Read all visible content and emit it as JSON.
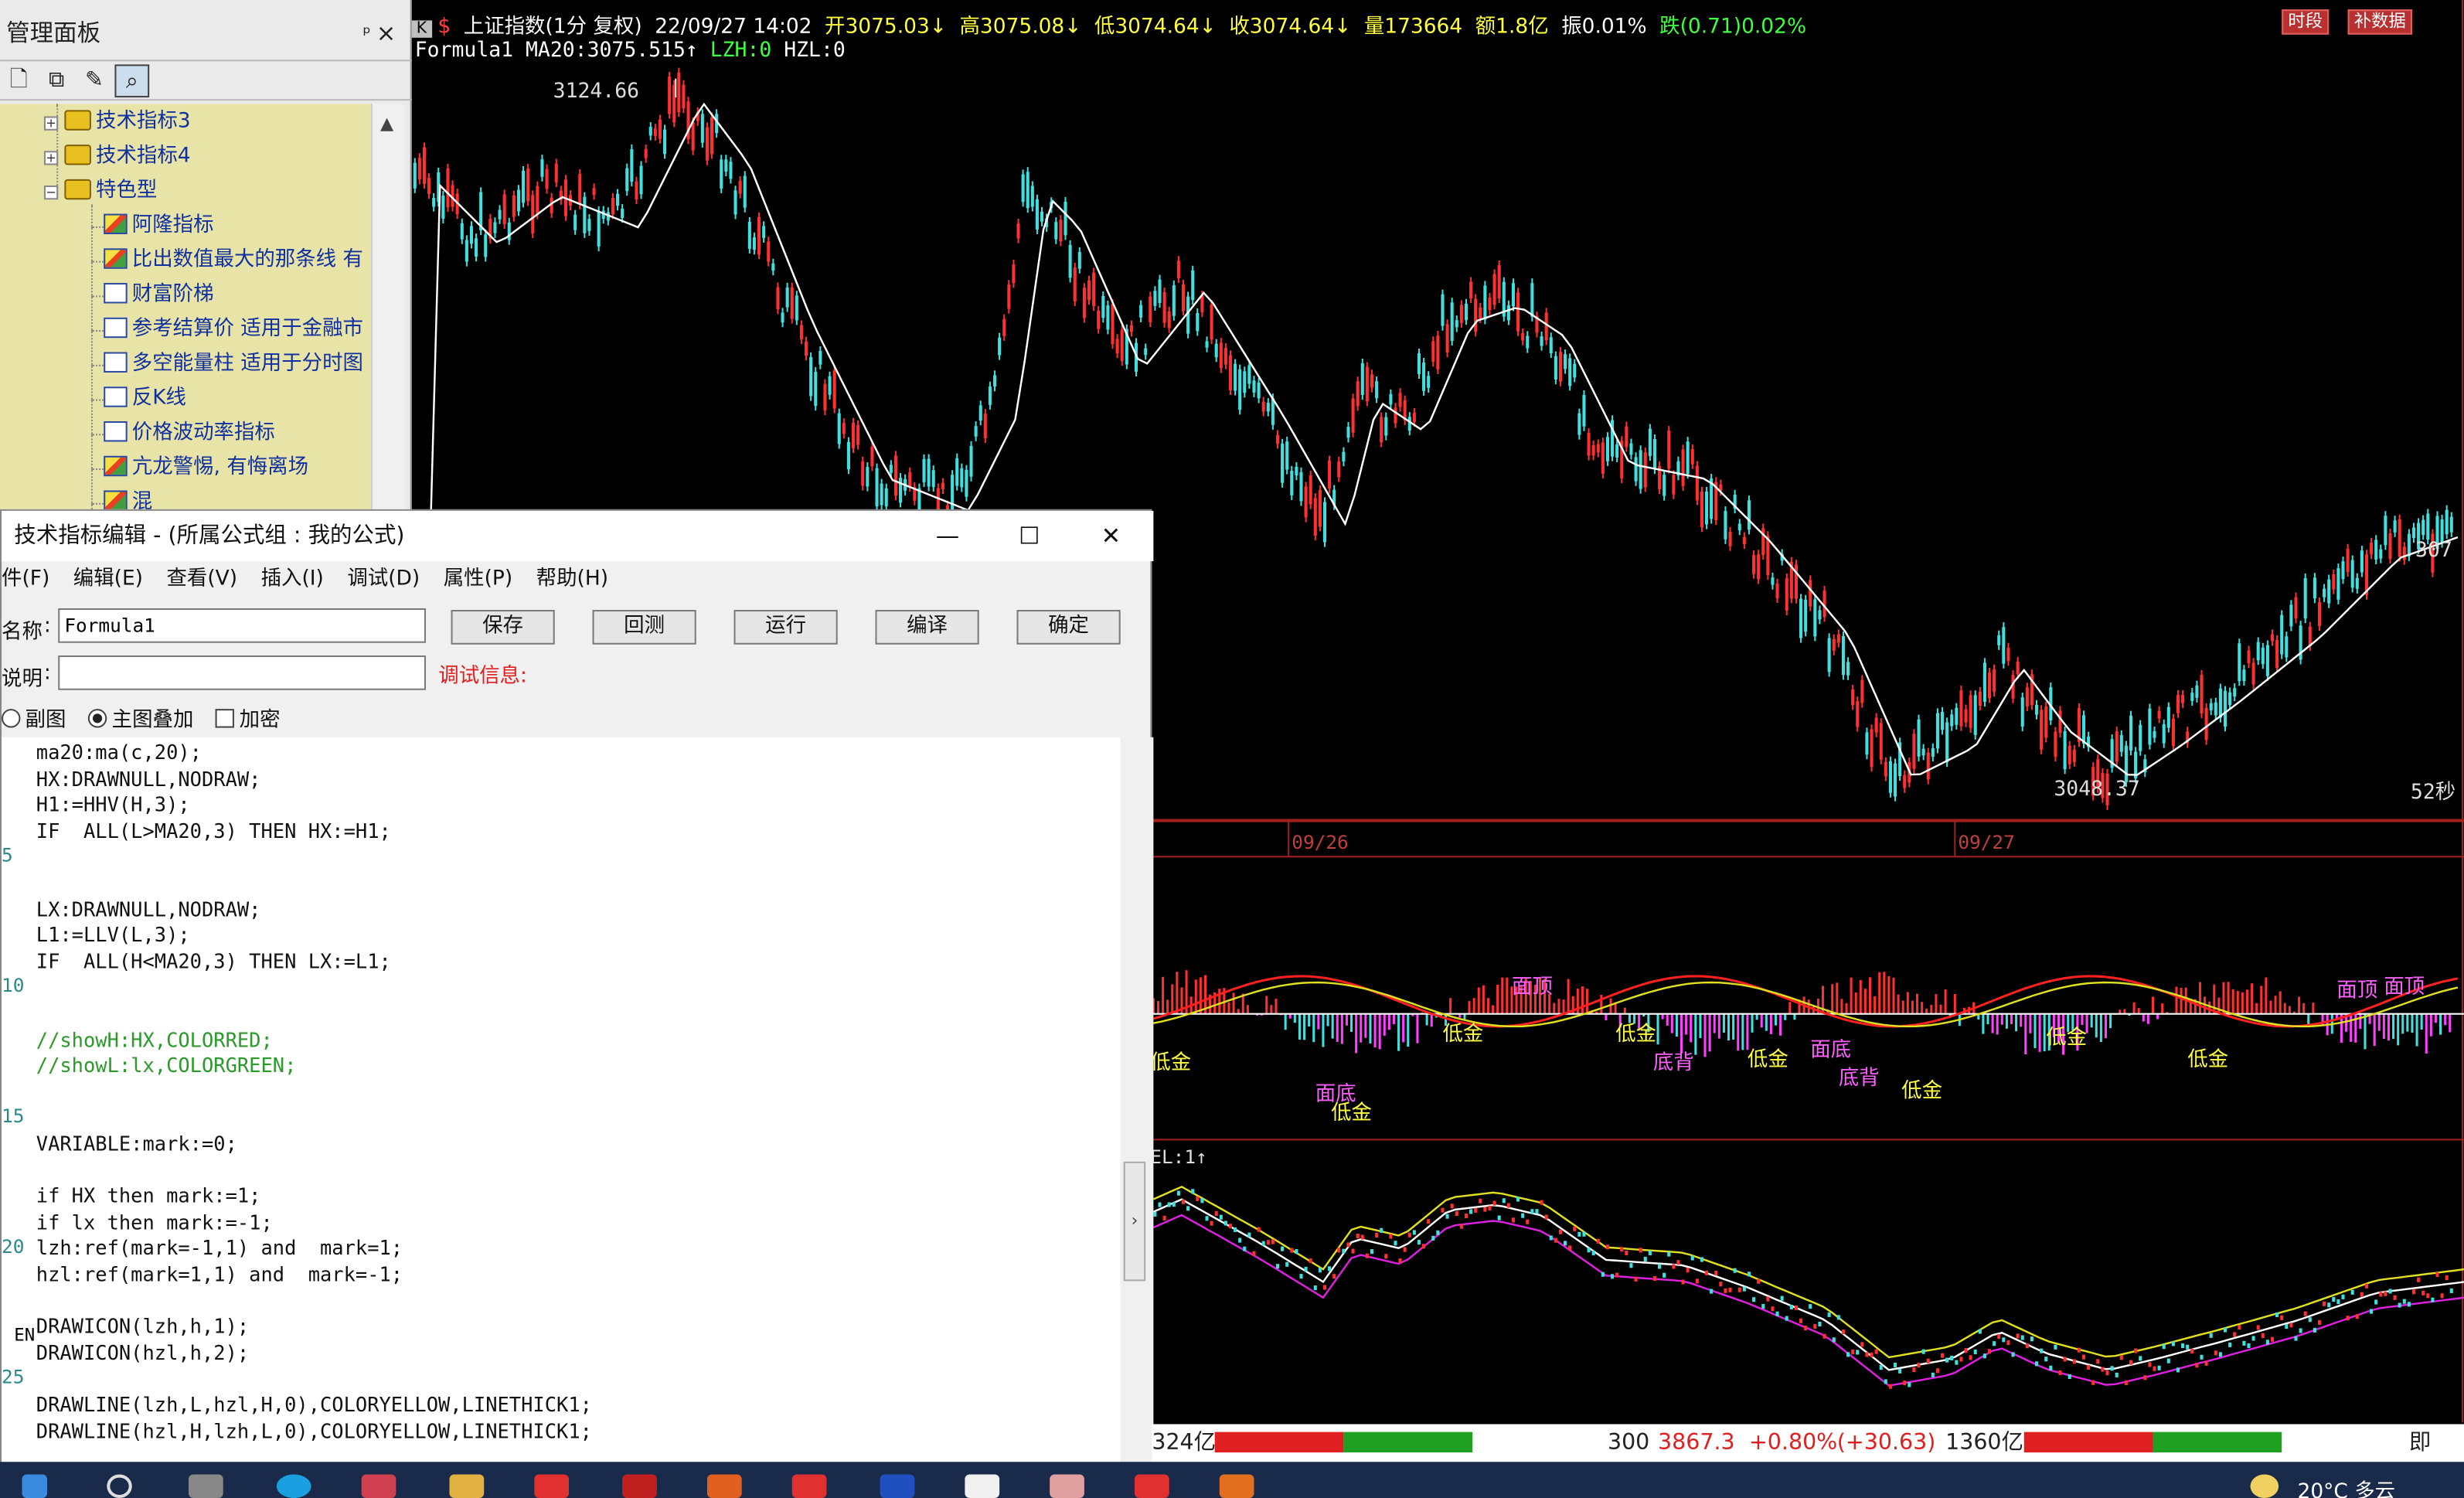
{
  "panel": {
    "title": "管理面板",
    "pin": "ᵖ",
    "close": "×",
    "tree": [
      {
        "label": "技术指标3",
        "type": "folder",
        "collapsed": true
      },
      {
        "label": "技术指标4",
        "type": "folder",
        "collapsed": true
      },
      {
        "label": "特色型",
        "type": "folder",
        "collapsed": false
      },
      {
        "label": "阿隆指标",
        "type": "item-k"
      },
      {
        "label": "比出数值最大的那条线 有",
        "type": "item-k"
      },
      {
        "label": "财富阶梯",
        "type": "item"
      },
      {
        "label": "参考结算价 适用于金融市",
        "type": "item"
      },
      {
        "label": "多空能量柱 适用于分时图",
        "type": "item"
      },
      {
        "label": "反K线",
        "type": "item"
      },
      {
        "label": "价格波动率指标",
        "type": "item"
      },
      {
        "label": "亢龙警惕, 有悔离场",
        "type": "item-k"
      },
      {
        "label": "混",
        "type": "item-k"
      }
    ]
  },
  "chart": {
    "header": {
      "badge": "K",
      "name": "上证指数(1分 复权)",
      "datetime": "22/09/27 14:02",
      "open": "开3075.03↓",
      "high": "高3075.08↓",
      "low": "低3074.64↓",
      "close": "收3074.64↓",
      "vol": "量173664",
      "amount": "额1.8亿",
      "amp": "振0.01%",
      "chg": "跌(0.71)0.02%",
      "btn1": "时段",
      "btn2": "补数据"
    },
    "formula_line": {
      "name": "Formula1",
      "ma": "MA20:3075.515↑",
      "lzh": "LZH:0",
      "hzl": "HZL:0"
    },
    "labels": {
      "peak": "3124.66",
      "trough": "3048.37",
      "right_price": "307",
      "countdown": "52秒",
      "date1": "09/26",
      "date2": "09/27",
      "sub2_label": "EL:1↑"
    },
    "signals": [
      {
        "t": "面顶",
        "c": "#ff60ff"
      },
      {
        "t": "低金",
        "c": "#ffff40"
      },
      {
        "t": "低金",
        "c": "#ffff40"
      },
      {
        "t": "底背",
        "c": "#ff60ff"
      },
      {
        "t": "低金",
        "c": "#ffff40"
      },
      {
        "t": "面底",
        "c": "#ff60ff"
      },
      {
        "t": "底背",
        "c": "#ff60ff"
      },
      {
        "t": "低金",
        "c": "#ffff40"
      },
      {
        "t": "低金",
        "c": "#ffff40"
      },
      {
        "t": "面顶",
        "c": "#ff60ff"
      },
      {
        "t": "面顶",
        "c": "#ff60ff"
      },
      {
        "t": "低金",
        "c": "#ffff40"
      },
      {
        "t": "面底",
        "c": "#ff60ff"
      },
      {
        "t": "低金",
        "c": "#ffff40"
      },
      {
        "t": "低金",
        "c": "#ffff40"
      }
    ]
  },
  "editor": {
    "title": "技术指标编辑 - (所属公式组 : 我的公式)",
    "menu": [
      "件(F)",
      "编辑(E)",
      "查看(V)",
      "插入(I)",
      "调试(D)",
      "属性(P)",
      "帮助(H)"
    ],
    "name_label": "名称",
    "name_value": "Formula1",
    "desc_label": "说明",
    "debug_label": "调试信息:",
    "buttons": [
      "保存",
      "回测",
      "运行",
      "编译",
      "确定"
    ],
    "radios": [
      {
        "label": "副图",
        "on": false
      },
      {
        "label": "主图叠加",
        "on": true
      }
    ],
    "checkbox": "加密",
    "ime": "EN",
    "lines": [
      "ma20:ma(c,20);",
      "HX:DRAWNULL,NODRAW;",
      "H1:=HHV(H,3);",
      "IF  ALL(L>MA20,3) THEN HX:=H1;",
      "",
      "",
      "LX:DRAWNULL,NODRAW;",
      "L1:=LLV(L,3);",
      "IF  ALL(H<MA20,3) THEN LX:=L1;",
      "",
      "",
      "//showH:HX,COLORRED;",
      "//showL:lx,COLORGREEN;",
      "",
      "",
      "VARIABLE:mark:=0;",
      "",
      "if HX then mark:=1;",
      "if lx then mark:=-1;",
      "lzh:ref(mark=-1,1) and  mark=1;",
      "hzl:ref(mark=1,1) and  mark=-1;",
      "",
      "DRAWICON(lzh,h,1);",
      "DRAWICON(hzl,h,2);",
      "",
      "DRAWLINE(lzh,L,hzl,H,0),COLORYELLOW,LINETHICK1;",
      "DRAWLINE(hzl,H,lzh,L,0),COLORYELLOW,LINETHICK1;"
    ],
    "line_numbers": [
      "5",
      "10",
      "15",
      "20",
      "25"
    ]
  },
  "bottom": {
    "left": "324亿",
    "code": "300",
    "price": "3867.3",
    "pct": "+0.80%",
    "chg": "(+30.63)",
    "amount": "1360亿",
    "right": "即"
  },
  "taskbar": {
    "weather": "20°C 多云"
  }
}
